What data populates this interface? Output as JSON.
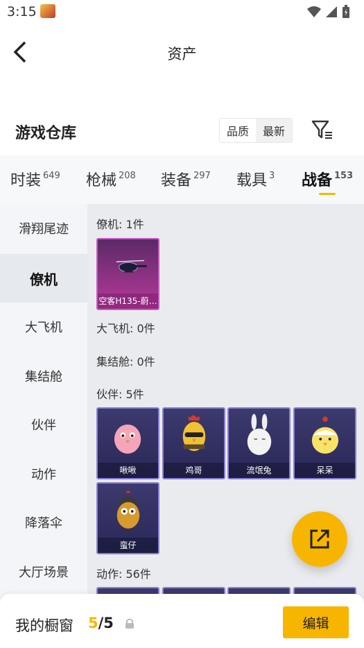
{
  "status": {
    "time": "3:15"
  },
  "header": {
    "title": "资产"
  },
  "section": {
    "title": "游戏仓库",
    "sort_options": [
      "品质",
      "最新"
    ]
  },
  "tabs": [
    {
      "label": "时装",
      "count": "649"
    },
    {
      "label": "枪械",
      "count": "208"
    },
    {
      "label": "装备",
      "count": "297"
    },
    {
      "label": "载具",
      "count": "3"
    },
    {
      "label": "战备",
      "count": "153"
    }
  ],
  "sidebar": {
    "items": [
      "滑翔尾迹",
      "僚机",
      "大飞机",
      "集结舱",
      "伙伴",
      "动作",
      "降落伞",
      "大厅场景"
    ]
  },
  "groups": {
    "wingman": {
      "label": "僚机: 1件",
      "items": [
        "空客H135-蔚…"
      ]
    },
    "big_plane": {
      "label": "大飞机: 0件"
    },
    "capsule": {
      "label": "集结舱: 0件"
    },
    "partner": {
      "label": "伙伴: 5件",
      "items": [
        "啾啾",
        "鸡哥",
        "流氓兔",
        "呆呆",
        "蛮仔"
      ]
    },
    "action": {
      "label": "动作: 56件"
    }
  },
  "bottom": {
    "window_label": "我的橱窗",
    "current": "5",
    "total": "/5",
    "edit_label": "编辑"
  },
  "colors": {
    "accent": "#f7b500",
    "card_border": "#8b7fd6",
    "card_purple": "#b9399a"
  }
}
